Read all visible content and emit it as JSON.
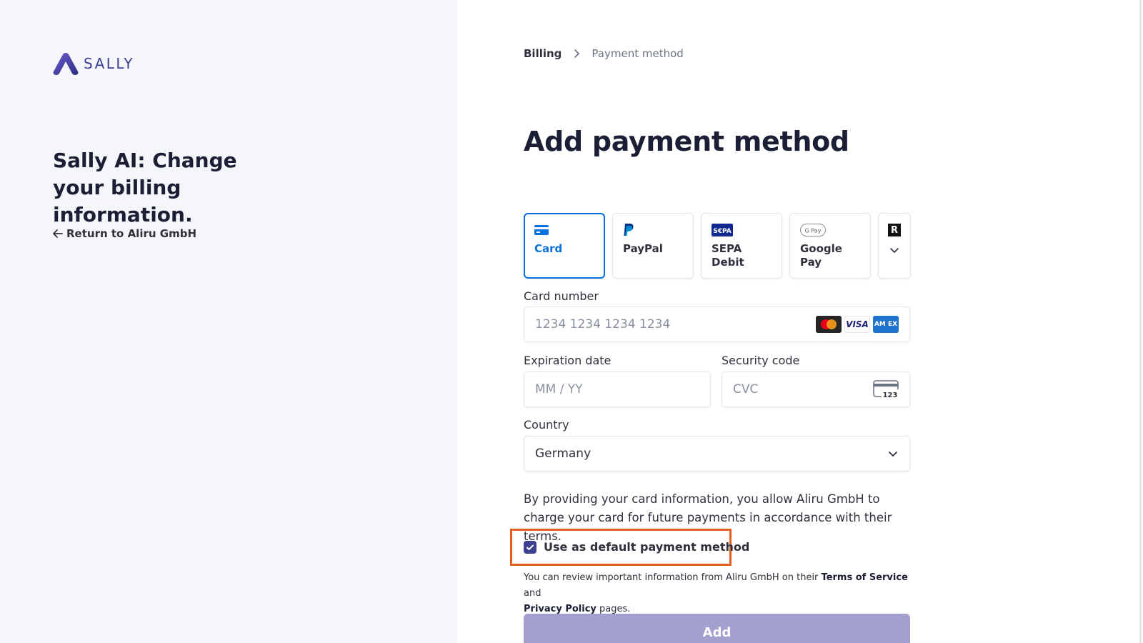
{
  "brand": {
    "name": "SALLY",
    "accent": "#3d3f8f"
  },
  "left": {
    "tagline": "Sally AI: Change your billing information.",
    "return_label": "Return to Aliru GmbH"
  },
  "breadcrumb": {
    "parent": "Billing",
    "current": "Payment method"
  },
  "page_title": "Add payment method",
  "payment_tabs": [
    {
      "label": "Card",
      "icon": "card-icon",
      "active": true
    },
    {
      "label": "PayPal",
      "icon": "paypal-icon",
      "active": false
    },
    {
      "label": "SEPA Debit",
      "icon": "sepa-icon",
      "active": false
    },
    {
      "label": "Google Pay",
      "icon": "google-pay-icon",
      "active": false
    }
  ],
  "more_tab": {
    "icon": "r-icon",
    "chevron": "chevron-down-icon"
  },
  "form": {
    "card_number_label": "Card number",
    "card_number_placeholder": "1234 1234 1234 1234",
    "card_brands": [
      "mastercard-icon",
      "visa-icon",
      "amex-icon"
    ],
    "visa_text": "VISA",
    "amex_text": "AM EX",
    "expiration_label": "Expiration date",
    "expiration_placeholder": "MM / YY",
    "security_label": "Security code",
    "security_placeholder": "CVC",
    "cvc_icon_text": "123",
    "country_label": "Country",
    "country_value": "Germany"
  },
  "consent_text": "By providing your card information, you allow Aliru GmbH to charge your card for future payments in accordance with their terms.",
  "default_checkbox": {
    "label": "Use as default payment method",
    "checked": true
  },
  "legal": {
    "prefix": "You can review important information from Aliru GmbH on their ",
    "terms": "Terms of Service",
    "and": " and ",
    "privacy": "Privacy Policy",
    "suffix": " pages."
  },
  "add_button": "Add",
  "colors": {
    "tab_active": "#0570de",
    "highlight": "#e2601e",
    "button": "#a3a0cf"
  }
}
